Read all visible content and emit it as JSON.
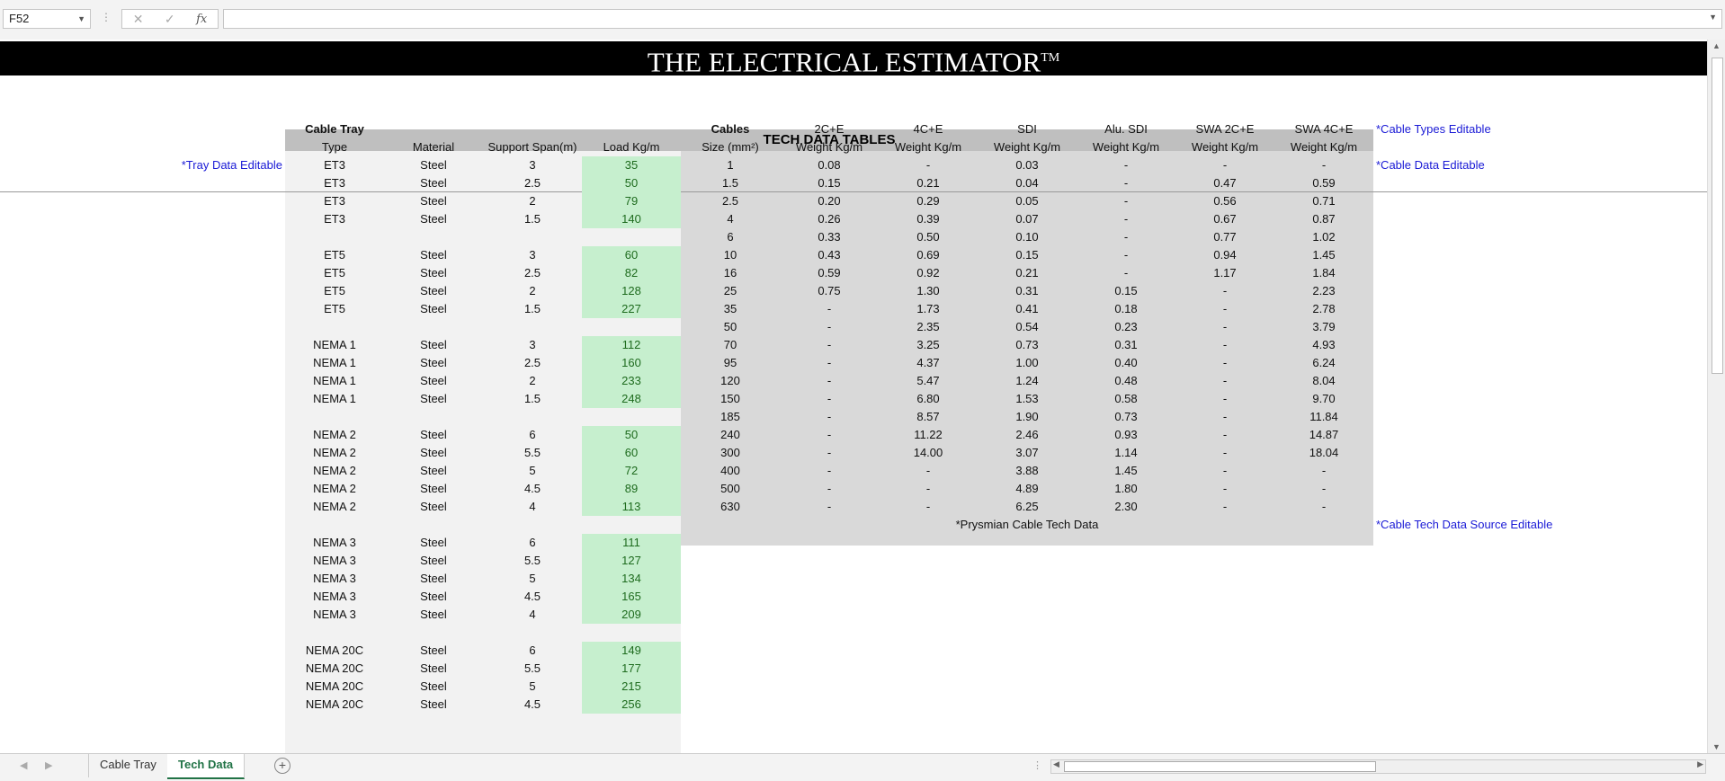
{
  "formula_bar": {
    "cell_ref": "F52",
    "formula": ""
  },
  "banner": {
    "title": "THE ELECTRICAL ESTIMATOR",
    "tm": "TM"
  },
  "tech_title": "TECH DATA TABLES",
  "tray": {
    "heading": "Cable Tray",
    "columns": [
      "Type",
      "Material",
      "Support Span(m)",
      "Load Kg/m"
    ],
    "rows": [
      [
        "ET3",
        "Steel",
        "3",
        "35"
      ],
      [
        "ET3",
        "Steel",
        "2.5",
        "50"
      ],
      [
        "ET3",
        "Steel",
        "2",
        "79"
      ],
      [
        "ET3",
        "Steel",
        "1.5",
        "140"
      ],
      null,
      [
        "ET5",
        "Steel",
        "3",
        "60"
      ],
      [
        "ET5",
        "Steel",
        "2.5",
        "82"
      ],
      [
        "ET5",
        "Steel",
        "2",
        "128"
      ],
      [
        "ET5",
        "Steel",
        "1.5",
        "227"
      ],
      null,
      [
        "NEMA 1",
        "Steel",
        "3",
        "112"
      ],
      [
        "NEMA 1",
        "Steel",
        "2.5",
        "160"
      ],
      [
        "NEMA 1",
        "Steel",
        "2",
        "233"
      ],
      [
        "NEMA 1",
        "Steel",
        "1.5",
        "248"
      ],
      null,
      [
        "NEMA 2",
        "Steel",
        "6",
        "50"
      ],
      [
        "NEMA 2",
        "Steel",
        "5.5",
        "60"
      ],
      [
        "NEMA 2",
        "Steel",
        "5",
        "72"
      ],
      [
        "NEMA 2",
        "Steel",
        "4.5",
        "89"
      ],
      [
        "NEMA 2",
        "Steel",
        "4",
        "113"
      ],
      null,
      [
        "NEMA 3",
        "Steel",
        "6",
        "111"
      ],
      [
        "NEMA 3",
        "Steel",
        "5.5",
        "127"
      ],
      [
        "NEMA 3",
        "Steel",
        "5",
        "134"
      ],
      [
        "NEMA 3",
        "Steel",
        "4.5",
        "165"
      ],
      [
        "NEMA 3",
        "Steel",
        "4",
        "209"
      ],
      null,
      [
        "NEMA 20C",
        "Steel",
        "6",
        "149"
      ],
      [
        "NEMA 20C",
        "Steel",
        "5.5",
        "177"
      ],
      [
        "NEMA 20C",
        "Steel",
        "5",
        "215"
      ],
      [
        "NEMA 20C",
        "Steel",
        "4.5",
        "256"
      ]
    ]
  },
  "cables": {
    "heading": "Cables",
    "size_header": "Size (mm²)",
    "types": [
      "2C+E",
      "4C+E",
      "SDI",
      "Alu. SDI",
      "SWA 2C+E",
      "SWA 4C+E"
    ],
    "weight_header": "Weight Kg/m",
    "rows": [
      [
        "1",
        "0.08",
        "-",
        "0.03",
        "-",
        "-",
        "-"
      ],
      [
        "1.5",
        "0.15",
        "0.21",
        "0.04",
        "-",
        "0.47",
        "0.59"
      ],
      [
        "2.5",
        "0.20",
        "0.29",
        "0.05",
        "-",
        "0.56",
        "0.71"
      ],
      [
        "4",
        "0.26",
        "0.39",
        "0.07",
        "-",
        "0.67",
        "0.87"
      ],
      [
        "6",
        "0.33",
        "0.50",
        "0.10",
        "-",
        "0.77",
        "1.02"
      ],
      [
        "10",
        "0.43",
        "0.69",
        "0.15",
        "-",
        "0.94",
        "1.45"
      ],
      [
        "16",
        "0.59",
        "0.92",
        "0.21",
        "-",
        "1.17",
        "1.84"
      ],
      [
        "25",
        "0.75",
        "1.30",
        "0.31",
        "0.15",
        "-",
        "2.23"
      ],
      [
        "35",
        "-",
        "1.73",
        "0.41",
        "0.18",
        "-",
        "2.78"
      ],
      [
        "50",
        "-",
        "2.35",
        "0.54",
        "0.23",
        "-",
        "3.79"
      ],
      [
        "70",
        "-",
        "3.25",
        "0.73",
        "0.31",
        "-",
        "4.93"
      ],
      [
        "95",
        "-",
        "4.37",
        "1.00",
        "0.40",
        "-",
        "6.24"
      ],
      [
        "120",
        "-",
        "5.47",
        "1.24",
        "0.48",
        "-",
        "8.04"
      ],
      [
        "150",
        "-",
        "6.80",
        "1.53",
        "0.58",
        "-",
        "9.70"
      ],
      [
        "185",
        "-",
        "8.57",
        "1.90",
        "0.73",
        "-",
        "11.84"
      ],
      [
        "240",
        "-",
        "11.22",
        "2.46",
        "0.93",
        "-",
        "14.87"
      ],
      [
        "300",
        "-",
        "14.00",
        "3.07",
        "1.14",
        "-",
        "18.04"
      ],
      [
        "400",
        "-",
        "-",
        "3.88",
        "1.45",
        "-",
        "-"
      ],
      [
        "500",
        "-",
        "-",
        "4.89",
        "1.80",
        "-",
        "-"
      ],
      [
        "630",
        "-",
        "-",
        "6.25",
        "2.30",
        "-",
        "-"
      ]
    ],
    "source": "*Prysmian Cable Tech Data"
  },
  "notes": {
    "tray_editable": "*Tray Data Editable",
    "cable_types_editable": "*Cable Types Editable",
    "cable_data_editable": "*Cable Data Editable",
    "source_editable": "*Cable Tech Data Source Editable"
  },
  "tabs": [
    "Cable Tray",
    "Tech Data"
  ],
  "active_tab": "Tech Data",
  "colors": {
    "banner_bg": "#000000",
    "load_fill": "#c6efce",
    "note_text": "#1a1ad6",
    "active_tab": "#217346"
  }
}
